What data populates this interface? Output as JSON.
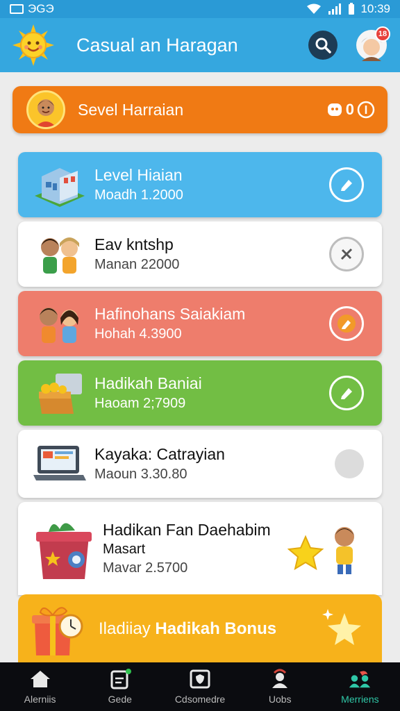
{
  "status_bar": {
    "left_text": "ЭGЭ",
    "time": "10:39"
  },
  "header": {
    "title": "Casual an Haragan"
  },
  "banner": {
    "title": "Sevel Harraian",
    "counter_text": "0"
  },
  "cards": [
    {
      "title": "Level Hiaian",
      "subtitle": "Moadh 1.2000",
      "color": "#4db7ec"
    },
    {
      "title": "Eav kntshp",
      "subtitle": "Manan 22000",
      "color": "#ffffff"
    },
    {
      "title": "Hafinohans Saiakiam",
      "subtitle": "Hohah 4.3900",
      "color": "#ee7d6c"
    },
    {
      "title": "Hadikah Baniai",
      "subtitle": "Haoam 2;7909",
      "color": "#72be44"
    },
    {
      "title": "Kayaka: Catrayian",
      "subtitle": "Maoun 3.30.80",
      "color": "#ffffff"
    },
    {
      "title": "Hadikan Fan Daehabim",
      "title_line2": "Masart",
      "subtitle": "Mavar 2.5700",
      "color": "#ffffff"
    }
  ],
  "bonus": {
    "prefix": "Iladiiay",
    "bold_text": "Hadikah Bonus",
    "color": "#f7b21b"
  },
  "nav": [
    {
      "label": "Alerniis",
      "icon": "home-icon"
    },
    {
      "label": "Gede",
      "icon": "calendar-icon"
    },
    {
      "label": "Cdsomedre",
      "icon": "shield-icon"
    },
    {
      "label": "Uobs",
      "icon": "user-icon"
    },
    {
      "label": "Merriens",
      "icon": "community-icon",
      "active": true
    }
  ],
  "colors": {
    "appbar": "#35a7df",
    "banner": "#f07a14",
    "nav_active": "#2fc7a7"
  }
}
